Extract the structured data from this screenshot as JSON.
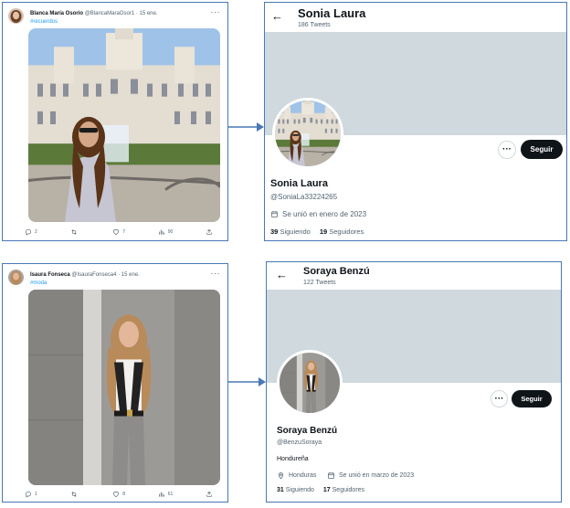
{
  "top_tweet": {
    "author_name": "Blanca María Osorio",
    "author_handle": "@BlancaMaraOsor1 · 15 ene.",
    "hashtag": "#recuerdos",
    "more": "···",
    "actions": {
      "replies": "2",
      "retweets": "",
      "likes": "7",
      "views": "90"
    }
  },
  "top_profile": {
    "back": "←",
    "header_name": "Sonia Laura",
    "tweet_count": "186 Tweets",
    "more": "···",
    "follow_label": "Seguir",
    "name": "Sonia Laura",
    "handle": "@SoniaLa33224265",
    "joined": "Se unió en enero de 2023",
    "following_count": "39",
    "following_label": "Siguiendo",
    "followers_count": "19",
    "followers_label": "Seguidores"
  },
  "bottom_tweet": {
    "author_name": "Isaura Fonseca",
    "author_handle": "@IsauraFonseca4 · 15 ene.",
    "hashtag": "#moda",
    "more": "···",
    "actions": {
      "replies": "1",
      "retweets": "",
      "likes": "8",
      "views": "61"
    }
  },
  "bottom_profile": {
    "back": "←",
    "header_name": "Soraya Benzú",
    "tweet_count": "122 Tweets",
    "more": "···",
    "follow_label": "Seguir",
    "name": "Soraya Benzú",
    "handle": "@BenzuSoraya",
    "bio": "Hondureña",
    "location": "Honduras",
    "joined": "Se unió en marzo de 2023",
    "following_count": "31",
    "following_label": "Siguiendo",
    "followers_count": "17",
    "followers_label": "Seguidores"
  },
  "colors": {
    "frame": "#4a78b5",
    "link": "#1d9bf0",
    "banner": "#cfd9de",
    "button": "#0f1419",
    "muted": "#536471"
  }
}
